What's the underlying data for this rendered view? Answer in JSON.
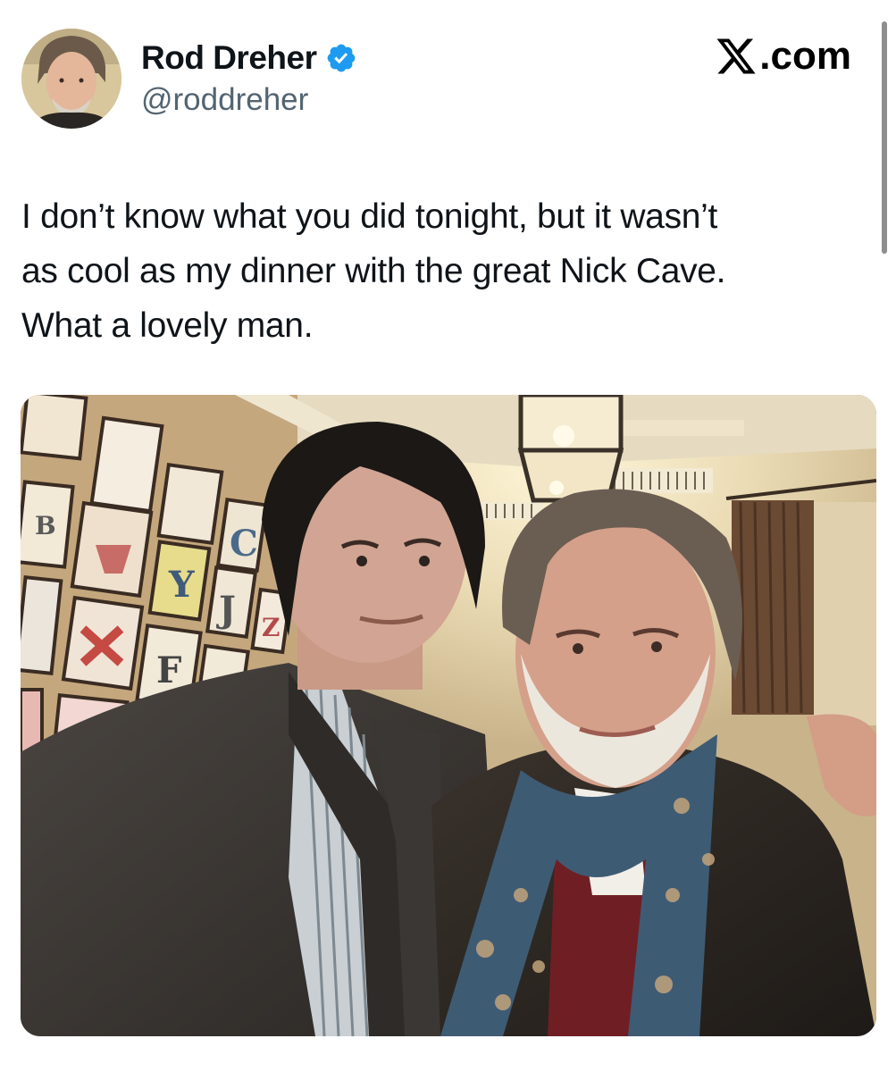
{
  "header": {
    "display_name": "Rod Dreher",
    "handle": "@roddreher",
    "verified_icon": "verified-badge-icon",
    "avatar_icon": "profile-avatar"
  },
  "brand": {
    "label": ".com",
    "icon": "x-logo-icon"
  },
  "tweet": {
    "lines": [
      "I don’t know what you did tonight, but it wasn’t",
      "as cool as my dinner with the great Nick Cave.",
      "What a lovely man."
    ]
  },
  "media": {
    "frame_letters": [
      "B",
      "C",
      "Y",
      "J",
      "Z",
      "F"
    ]
  },
  "colors": {
    "verified_blue": "#1d9bf0",
    "text": "#0f1419",
    "secondary_text": "#536471"
  }
}
